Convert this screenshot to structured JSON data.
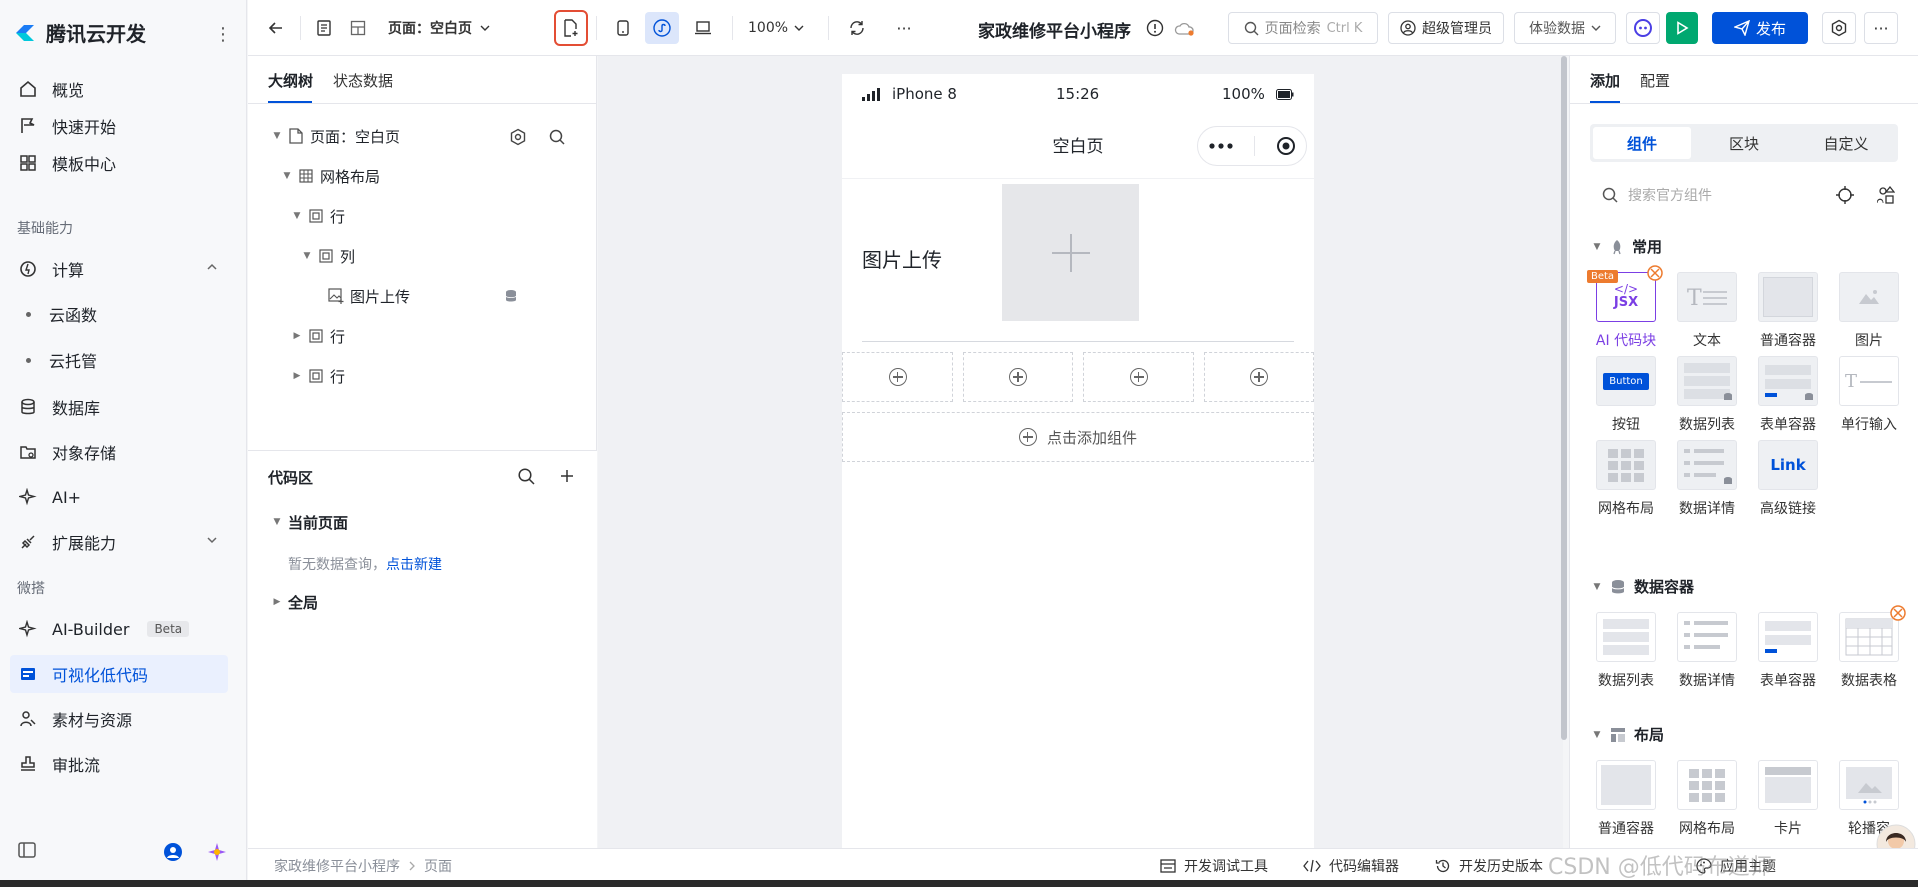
{
  "nav": {
    "brand": "腾讯云开发",
    "items": [
      {
        "label": "概览"
      },
      {
        "label": "快速开始"
      },
      {
        "label": "模板中心"
      }
    ],
    "group_basic": "基础能力",
    "compute": "计算",
    "compute_sub": [
      "云函数",
      "云托管"
    ],
    "items2": [
      {
        "label": "数据库"
      },
      {
        "label": "对象存储"
      },
      {
        "label": "AI+"
      },
      {
        "label": "扩展能力"
      }
    ],
    "group_micro": "微搭",
    "ai_builder": "AI-Builder",
    "ai_builder_tag": "Beta",
    "lowcode": "可视化低代码",
    "materials": "素材与资源",
    "approval": "审批流"
  },
  "toolbar": {
    "page_select": "页面：空白页",
    "zoom": "100%",
    "more": "···",
    "app_title": "家政维修平台小程序",
    "search": "页面检索",
    "search_shortcut": "Ctrl K",
    "role": "超级管理员",
    "data_mode": "体验数据",
    "publish": "发布"
  },
  "outline": {
    "tabs": [
      "大纲树",
      "状态数据"
    ],
    "tree": [
      {
        "label": "页面：空白页"
      },
      {
        "label": "网格布局"
      },
      {
        "label": "行"
      },
      {
        "label": "列"
      },
      {
        "label": "图片上传"
      },
      {
        "label": "行"
      },
      {
        "label": "行"
      }
    ]
  },
  "code": {
    "title": "代码区",
    "current_page": "当前页面",
    "empty_text": "暂无数据查询，",
    "create_link": "点击新建",
    "global": "全局"
  },
  "phone": {
    "carrier": "iPhone 8",
    "time": "15:26",
    "battery": "100%",
    "page_title": "空白页",
    "image_upload_label": "图片上传",
    "add_component": "点击添加组件"
  },
  "right": {
    "tabs": [
      "添加",
      "配置"
    ],
    "segments": [
      "组件",
      "区块",
      "自定义"
    ],
    "search_placeholder": "搜索官方组件",
    "sections": [
      {
        "title": "常用",
        "items": [
          "AI 代码块",
          "文本",
          "普通容器",
          "图片",
          "按钮",
          "数据列表",
          "表单容器",
          "单行输入",
          "网格布局",
          "数据详情",
          "高级链接"
        ]
      },
      {
        "title": "数据容器",
        "items": [
          "数据列表",
          "数据详情",
          "表单容器",
          "数据表格"
        ]
      },
      {
        "title": "布局",
        "items": [
          "普通容器",
          "网格布局",
          "卡片",
          "轮播容"
        ]
      }
    ],
    "beta_badge": "Beta",
    "jsx_text": "JSX",
    "button_thumb": "Button",
    "link_thumb": "Link"
  },
  "bottombar": {
    "breadcrumb": [
      "家政维修平台小程序",
      "页面"
    ],
    "dev_tools": "开发调试工具",
    "code_editor": "代码编辑器",
    "history": "开发历史版本",
    "theme": "应用主题"
  },
  "watermark": "CSDN @低代码布道师",
  "colors": {
    "primary": "#0052d9",
    "run": "#00a870",
    "highlight_border": "#e34d34",
    "ai_purple": "#7b3fe4",
    "beta_orange": "#ed7b2f"
  }
}
